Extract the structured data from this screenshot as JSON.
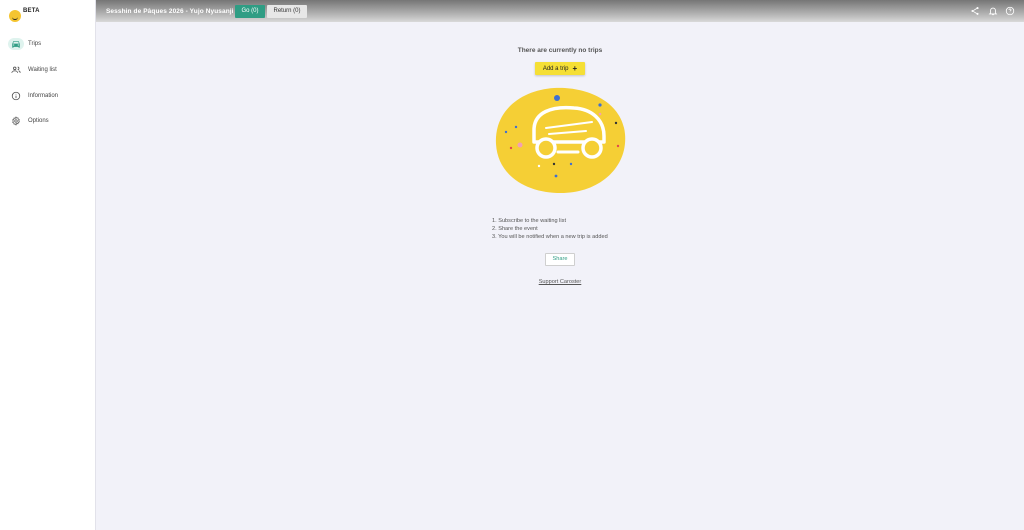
{
  "brand": {
    "badge": "BETA"
  },
  "sidebar": {
    "items": [
      {
        "label": "Trips",
        "icon": "car-icon",
        "active": true
      },
      {
        "label": "Waiting list",
        "icon": "people-icon",
        "active": false
      },
      {
        "label": "Information",
        "icon": "info-icon",
        "active": false
      },
      {
        "label": "Options",
        "icon": "gear-icon",
        "active": false
      }
    ]
  },
  "header": {
    "title": "Sesshin de Pâques 2026 - Yujo Nyusanji",
    "tabs": [
      {
        "label": "Go (0)",
        "active": true
      },
      {
        "label": "Return (0)",
        "active": false
      }
    ],
    "icons": [
      "share-icon",
      "bell-icon",
      "help-icon"
    ]
  },
  "main": {
    "empty_title": "There are currently no trips",
    "add_trip_label": "Add a trip",
    "add_trip_icon": "+",
    "steps": [
      "1. Subscribe to the waiting list",
      "2. Share the event",
      "3. You will be notified when a new trip is added"
    ],
    "share_label": "Share",
    "support_label": "Support Caroster"
  },
  "colors": {
    "accent": "#2f9d84",
    "primary": "#f5df35",
    "background": "#f2f2f9"
  }
}
